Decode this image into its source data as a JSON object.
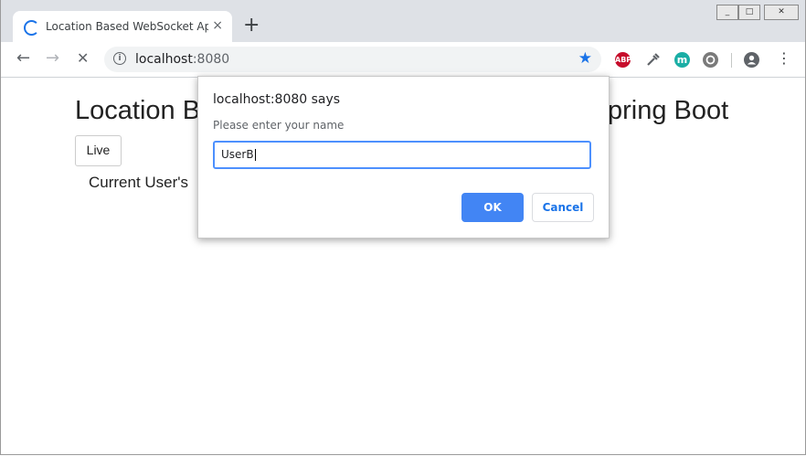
{
  "browser": {
    "tab_title": "Location Based WebSocket Appli",
    "tab_close": "×",
    "new_tab": "+",
    "url_host": "localhost",
    "url_port": ":8080",
    "back_icon": "←",
    "forward_icon": "→",
    "reload_icon": "✕",
    "info_icon": "i",
    "star_icon": "★",
    "extensions": [
      {
        "name": "abp-icon",
        "label": "ABP",
        "color": "#c70d2c"
      },
      {
        "name": "dropper-icon",
        "label": "",
        "color": "#5f6368"
      },
      {
        "name": "m-extension-icon",
        "label": "m",
        "color": "#1aaea5"
      },
      {
        "name": "sync-icon",
        "label": "",
        "color": "#7a7a7a"
      }
    ],
    "profile_icon": "●",
    "menu_icon": "⋮",
    "window_buttons": [
      "_",
      "□",
      "✕"
    ]
  },
  "page": {
    "title_left": "Location B",
    "title_right": "pring Boot",
    "live_button": "Live",
    "current_user": "Current User's"
  },
  "dialog": {
    "title": "localhost:8080 says",
    "message": "Please enter your name",
    "input_value": "UserB",
    "ok_label": "OK",
    "cancel_label": "Cancel"
  },
  "colors": {
    "accent": "#1a73e8",
    "ok_button": "#4285f4",
    "titlebar": "#dee1e6"
  }
}
